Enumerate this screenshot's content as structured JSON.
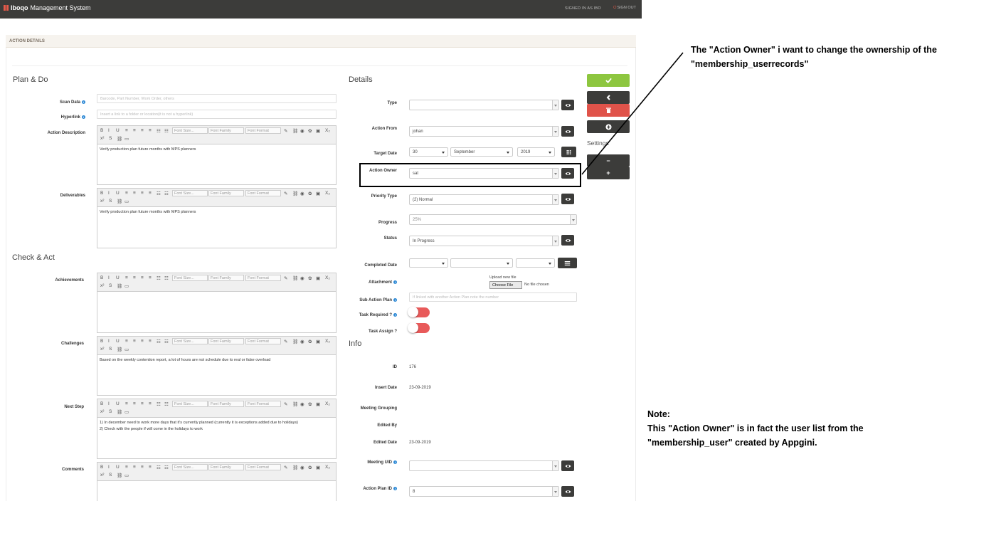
{
  "app": {
    "brand_bold": "Iboqo",
    "brand_rest": "Management System",
    "signed_in": "SIGNED IN AS IBO",
    "sign_out": "SIGN OUT"
  },
  "panel": {
    "title": "ACTION DETAILS"
  },
  "plan_do": {
    "heading": "Plan & Do",
    "scan_data": {
      "label": "Scan Data",
      "placeholder": "Barcode, Part Number, Work Order, others"
    },
    "hyperlink": {
      "label": "Hyperlink",
      "placeholder": "Insert a link to a folder or location(it is not a hyperlink)"
    },
    "action_description": {
      "label": "Action Description",
      "text": "Verify production plan future months with MPS planners"
    },
    "deliverables": {
      "label": "Deliverables",
      "text": "Verify production plan future months with MPS planners"
    }
  },
  "check_act": {
    "heading": "Check & Act",
    "achievements": {
      "label": "Achievements",
      "text": ""
    },
    "challenges": {
      "label": "Challenges",
      "text": "Based on the weekly contention report, a lot of hours are not schedule due to real or false overload"
    },
    "next_step": {
      "label": "Next Step",
      "line1": "1) In december need to work more days that it's currently planned (currently it is exceptions added due to holidays)",
      "line2": "2) Check with the people if will come in the holidays to work"
    },
    "comments": {
      "label": "Comments",
      "text": ""
    }
  },
  "toolbar": {
    "bold": "B",
    "italic": "I",
    "underline": "U",
    "font_size": "Font Size...",
    "font_family": "Font Family",
    "font_format": "Font Format",
    "sub": "X₂",
    "sup": "x²",
    "strike": "S"
  },
  "details": {
    "heading": "Details",
    "type": {
      "label": "Type",
      "value": ""
    },
    "action_from": {
      "label": "Action From",
      "value": "johan"
    },
    "target_date": {
      "label": "Target Date",
      "day": "30",
      "month": "September",
      "year": "2019"
    },
    "action_owner": {
      "label": "Action Owner",
      "value": "sat"
    },
    "priority_type": {
      "label": "Priority Type",
      "value": "(2) Normal"
    },
    "progress": {
      "label": "Progress",
      "value": "25%"
    },
    "status": {
      "label": "Status",
      "value": "In Progress"
    },
    "completed_date": {
      "label": "Completed Date"
    },
    "attachment": {
      "label": "Attachment",
      "upload_text": "Upload new file",
      "choose": "Choose File",
      "no_file": "No file chosen"
    },
    "sub_action_plan": {
      "label": "Sub Action Plan",
      "placeholder": "If linked with another Action Plan note the number"
    },
    "task_required": {
      "label": "Task Required ?"
    },
    "task_assign": {
      "label": "Task Assign ?"
    }
  },
  "info": {
    "heading": "Info",
    "id": {
      "label": "ID",
      "value": "176"
    },
    "insert_date": {
      "label": "Insert Date",
      "value": "23-09-2019"
    },
    "meeting_grouping": {
      "label": "Meeting Grouping",
      "value": ""
    },
    "edited_by": {
      "label": "Edited By",
      "value": ""
    },
    "edited_date": {
      "label": "Edited Date",
      "value": "23-09-2019"
    },
    "meeting_uid": {
      "label": "Meeting UID",
      "value": ""
    },
    "action_plan_id": {
      "label": "Action Plan ID",
      "value": "8"
    }
  },
  "sidebar": {
    "settings": "Settings",
    "save_icon": "check-icon",
    "back_icon": "chevron-left-icon",
    "delete_icon": "trash-icon",
    "add_icon": "plus-circle-icon",
    "minus": "−",
    "plus": "+"
  },
  "annotations": {
    "top_line1": "The \"Action Owner\" i want to change the ownership of the",
    "top_line2": "\"membership_userrecords\"",
    "note_title": "Note:",
    "note_line1": "This \"Action Owner\" is in fact the user list from the",
    "note_line2": "\"membership_user\" created by Appgini."
  },
  "colors": {
    "navbar": "#3c3c3a",
    "save": "#8dc63f",
    "delete": "#e0534a",
    "toggle": "#e85a5a",
    "info_icon": "#2f8ad6"
  }
}
